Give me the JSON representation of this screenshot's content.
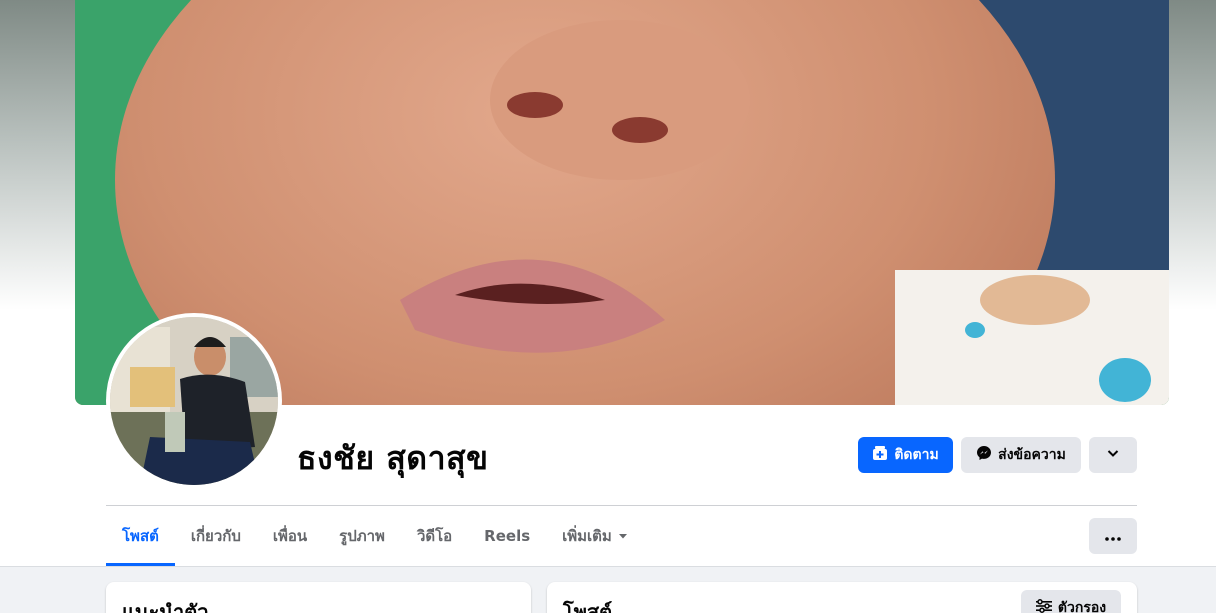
{
  "profile": {
    "name": "ธงชัย สุดาสุข"
  },
  "actions": {
    "follow_label": "ติดตาม",
    "message_label": "ส่งข้อความ"
  },
  "tabs": [
    {
      "label": "โพสต์",
      "active": true
    },
    {
      "label": "เกี่ยวกับ",
      "active": false
    },
    {
      "label": "เพื่อน",
      "active": false
    },
    {
      "label": "รูปภาพ",
      "active": false
    },
    {
      "label": "วิดีโอ",
      "active": false
    },
    {
      "label": "Reels",
      "active": false
    },
    {
      "label": "เพิ่มเติม",
      "active": false
    }
  ],
  "cards": {
    "intro_title": "แนะนำตัว",
    "posts_title": "โพสต์",
    "filter_label": "ตัวกรอง"
  },
  "colors": {
    "accent": "#0866ff",
    "secondary_button": "#e4e6eb",
    "feed_background": "#f0f2f5"
  }
}
